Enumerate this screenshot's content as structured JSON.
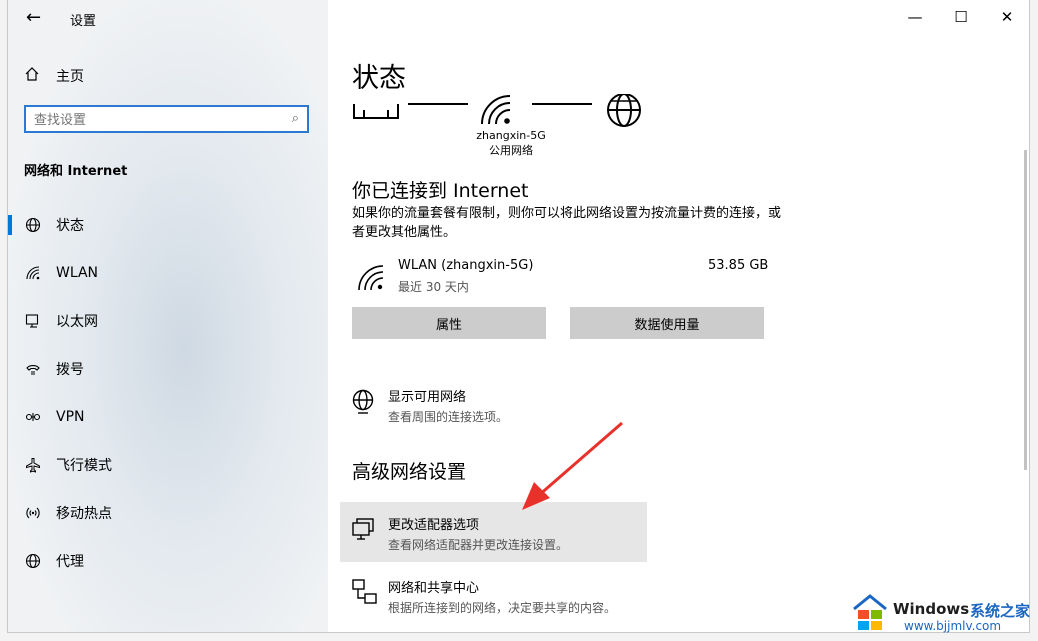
{
  "window": {
    "title": "设置",
    "back_glyph": "←"
  },
  "window_controls": {
    "minimize": "—",
    "maximize": "☐",
    "close": "✕"
  },
  "sidebar": {
    "home": "主页",
    "search_placeholder": "查找设置",
    "section": "网络和 Internet",
    "items": [
      {
        "label": "状态",
        "icon": "globe-icon",
        "active": true
      },
      {
        "label": "WLAN",
        "icon": "wifi-icon",
        "active": false
      },
      {
        "label": "以太网",
        "icon": "ethernet-icon",
        "active": false
      },
      {
        "label": "拨号",
        "icon": "dialup-icon",
        "active": false
      },
      {
        "label": "VPN",
        "icon": "vpn-icon",
        "active": false
      },
      {
        "label": "飞行模式",
        "icon": "airplane-icon",
        "active": false
      },
      {
        "label": "移动热点",
        "icon": "hotspot-icon",
        "active": false
      },
      {
        "label": "代理",
        "icon": "globe-icon",
        "active": false
      }
    ]
  },
  "main": {
    "title": "状态",
    "network_name": "zhangxin-5G",
    "network_type": "公用网络",
    "connected_heading": "你已连接到 Internet",
    "connected_desc": "如果你的流量套餐有限制，则你可以将此网络设置为按流量计费的连接，或者更改其他属性。",
    "usage": {
      "name": "WLAN (zhangxin-5G)",
      "period": "最近 30 天内",
      "amount": "53.85 GB"
    },
    "buttons": {
      "properties": "属性",
      "data_usage": "数据使用量"
    },
    "show_networks": {
      "title": "显示可用网络",
      "desc": "查看周围的连接选项。"
    },
    "advanced_heading": "高级网络设置",
    "adapter_options": {
      "title": "更改适配器选项",
      "desc": "查看网络适配器并更改连接设置。"
    },
    "sharing_center": {
      "title": "网络和共享中心",
      "desc": "根据所连接到的网络，决定要共享的内容。"
    }
  },
  "watermark": {
    "brand": "Windows",
    "cn": "系统之家",
    "url": "www.bjjmlv.com"
  },
  "colors": {
    "accent": "#0078d7",
    "arrow": "#e8312a"
  }
}
